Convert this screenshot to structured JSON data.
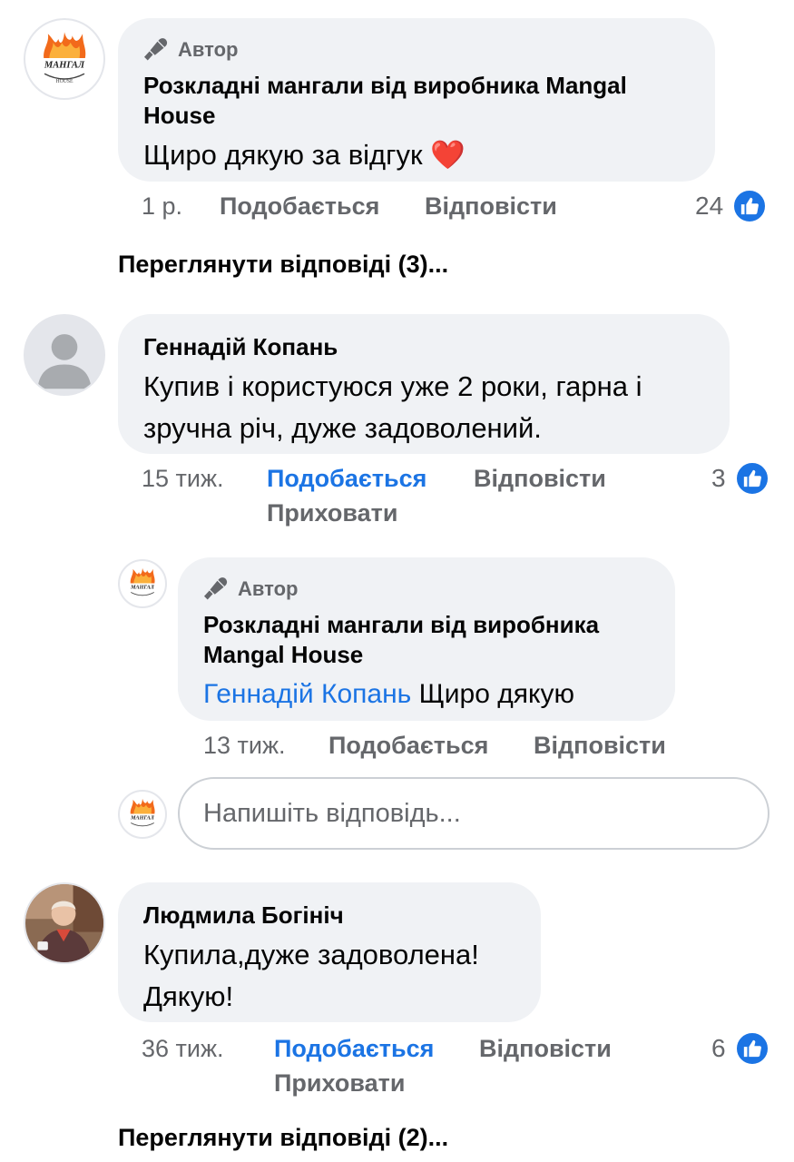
{
  "comments": [
    {
      "author_tag": "Автор",
      "name": "Розкладні мангали від виробника Mangal House",
      "text": "Щиро дякую за відгук",
      "emoji": "❤️",
      "time": "1 р.",
      "like": "Подобається",
      "reply": "Відповісти",
      "reaction_count": "24",
      "view_replies": "Переглянути відповіді (3)..."
    },
    {
      "name": "Геннадій Копань",
      "text": "Купив і користуюся уже 2 роки, гарна і зручна річ, дуже задоволений.",
      "time": "15 тиж.",
      "like": "Подобається",
      "reply": "Відповісти",
      "hide": "Приховати",
      "reaction_count": "3",
      "replies": [
        {
          "author_tag": "Автор",
          "name": "Розкладні мангали від виробника Mangal House",
          "mention": "Геннадій Копань",
          "text": "Щиро дякую",
          "time": "13 тиж.",
          "like": "Подобається",
          "reply": "Відповісти"
        }
      ],
      "reply_input_placeholder": "Напишіть відповідь..."
    },
    {
      "name": "Людмила Богініч",
      "text": "Купила,дуже задоволена! Дякую!",
      "time": "36 тиж.",
      "like": "Подобається",
      "reply": "Відповісти",
      "hide": "Приховати",
      "reaction_count": "6",
      "view_replies": "Переглянути відповіді (2)..."
    }
  ],
  "logo": {
    "word": "МАНГАЛ",
    "sub": "HOUSE"
  },
  "colors": {
    "accent": "#1b74e4",
    "bubble": "#f0f2f5",
    "muted": "#65676b"
  }
}
